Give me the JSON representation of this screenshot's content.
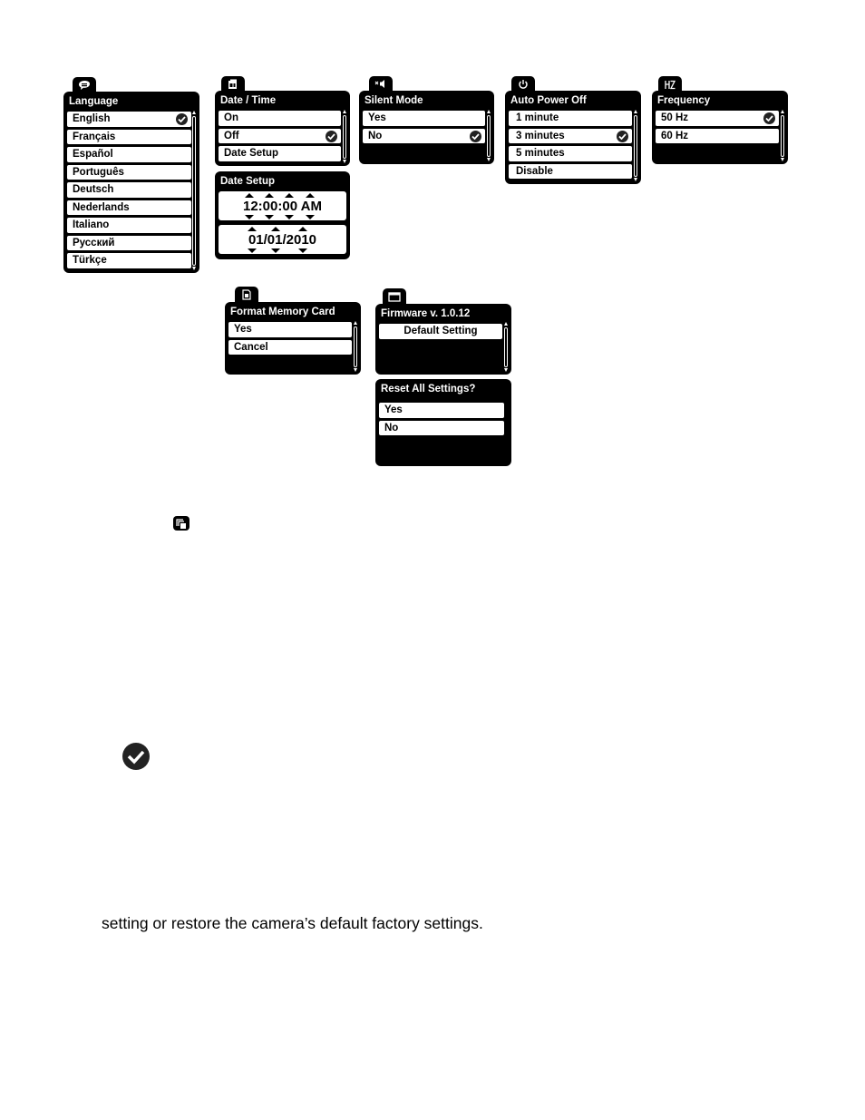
{
  "menus": {
    "language": {
      "icon": "speech-bubble-icon",
      "title": "Language",
      "items": [
        "English",
        "Français",
        "Español",
        "Português",
        "Deutsch",
        "Nederlands",
        "Italiano",
        "Русский",
        "Türkçe"
      ],
      "selected": "English"
    },
    "date_time": {
      "icon": "calendar-icon",
      "title": "Date / Time",
      "items": [
        "On",
        "Off",
        "Date Setup"
      ],
      "selected": "Off"
    },
    "date_setup": {
      "title": "Date Setup",
      "time": "12:00:00 AM",
      "date": "01/01/2010"
    },
    "silent_mode": {
      "icon": "mute-speaker-icon",
      "title": "Silent Mode",
      "items": [
        "Yes",
        "No"
      ],
      "selected": "No"
    },
    "auto_power_off": {
      "icon": "power-icon",
      "title": "Auto Power Off",
      "items": [
        "1 minute",
        "3 minutes",
        "5 minutes",
        "Disable"
      ],
      "selected": "3 minutes"
    },
    "frequency": {
      "icon": "hz-icon",
      "title": "Frequency",
      "items": [
        "50 Hz",
        "60 Hz"
      ],
      "selected": "50 Hz"
    },
    "format_memory_card": {
      "icon": "sd-card-icon",
      "title": "Format Memory Card",
      "items": [
        "Yes",
        "Cancel"
      ]
    },
    "firmware": {
      "icon": "window-icon",
      "title": "Firmware v. 1.0.12",
      "items": [
        "Default Setting"
      ]
    },
    "reset_all": {
      "title": "Reset All Settings?",
      "items": [
        "Yes",
        "No"
      ]
    }
  },
  "inline_icons": {
    "setup_menu_icon": "stacked-squares-icon",
    "check_icon": "check-circle-icon"
  },
  "body_text": "setting or restore the camera’s default factory settings."
}
